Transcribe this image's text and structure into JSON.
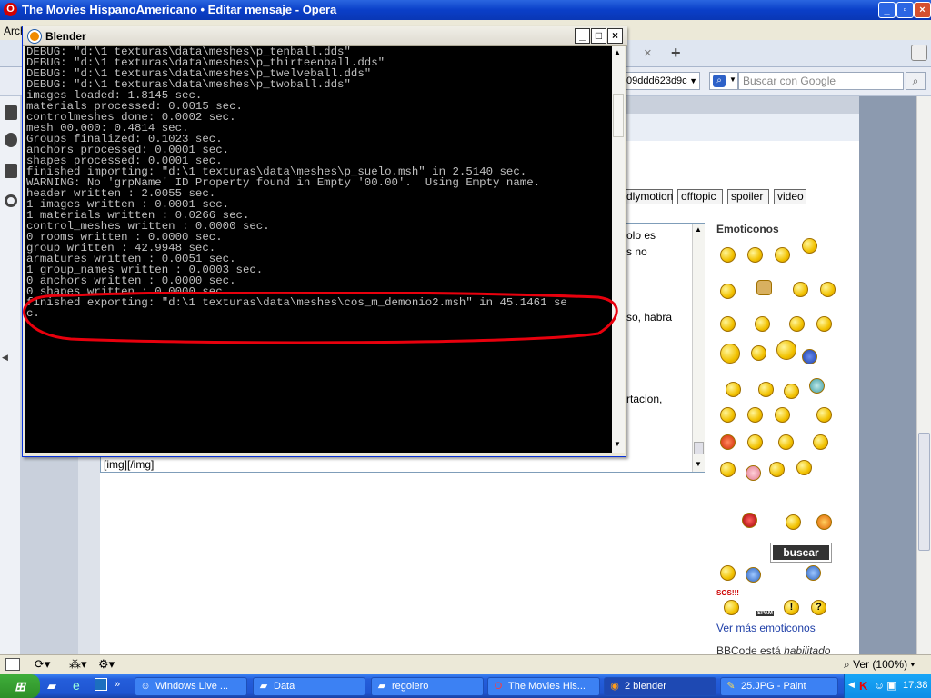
{
  "opera": {
    "title": "The Movies HispanoAmericano • Editar mensaje - Opera",
    "menu_first": "Arch",
    "url_fragment": "09ddd623d9c",
    "search_placeholder": "Buscar con Google",
    "tab_close": "×",
    "tab_new": "+"
  },
  "bbcode_buttons": [
    "dlymotion",
    "offtopic",
    "spoiler",
    "video"
  ],
  "editor": {
    "text_lines": [
      "olo es",
      "s no",
      "so, habra",
      "rtacion,"
    ],
    "img_tag": "[img][/img]"
  },
  "emoticons": {
    "heading": "Emoticonos",
    "more_link": "Ver más emoticonos",
    "bbcode_status_prefix": "BBCode está",
    "bbcode_status_value": "habilitado",
    "buscar_label": "buscar",
    "sos_label": "SOS!!!",
    "spam_label": "SPAM"
  },
  "statusbar": {
    "zoom": "Ver (100%)"
  },
  "blender": {
    "title": "Blender",
    "lines": [
      "DEBUG: \"d:\\1 texturas\\data\\meshes\\p_tenball.dds\"",
      "DEBUG: \"d:\\1 texturas\\data\\meshes\\p_thirteenball.dds\"",
      "DEBUG: \"d:\\1 texturas\\data\\meshes\\p_twelveball.dds\"",
      "DEBUG: \"d:\\1 texturas\\data\\meshes\\p_twoball.dds\"",
      "images loaded: 1.8145 sec.",
      "materials processed: 0.0015 sec.",
      "controlmeshes done: 0.0002 sec.",
      "mesh 00.000: 0.4814 sec.",
      "Groups finalized: 0.1023 sec.",
      "anchors processed: 0.0001 sec.",
      "shapes processed: 0.0001 sec.",
      "finished importing: \"d:\\1 texturas\\data\\meshes\\p_suelo.msh\" in 2.5140 sec.",
      "WARNING: No 'grpName' ID Property found in Empty '00.00'.  Using Empty name.",
      "header written : 2.0055 sec.",
      "1 images written : 0.0001 sec.",
      "1 materials written : 0.0266 sec.",
      "control_meshes written : 0.0000 sec.",
      "0 rooms written : 0.0000 sec.",
      "group written : 42.9948 sec.",
      "armatures written : 0.0051 sec.",
      "1 group_names written : 0.0003 sec.",
      "0 anchors written : 0.0000 sec.",
      "0 shapes written : 0.0000 sec.",
      "finished exporting: \"d:\\1 texturas\\data\\meshes\\cos_m_demonio2.msh\" in 45.1461 se",
      "c."
    ]
  },
  "taskbar": {
    "items": [
      {
        "label": "Windows Live ...",
        "icon": "messenger-icon"
      },
      {
        "label": "Data",
        "icon": "folder-icon"
      },
      {
        "label": "regolero",
        "icon": "folder-icon"
      },
      {
        "label": "The Movies His...",
        "icon": "opera-icon"
      },
      {
        "label": "2 blender",
        "icon": "blender-icon"
      },
      {
        "label": "25.JPG - Paint",
        "icon": "paint-icon"
      }
    ],
    "clock": "17:38"
  },
  "colors": {
    "console_bg": "#000000",
    "console_text": "#c0c0c0",
    "highlight": "#e8000d",
    "xp_blue": "#245edb"
  }
}
